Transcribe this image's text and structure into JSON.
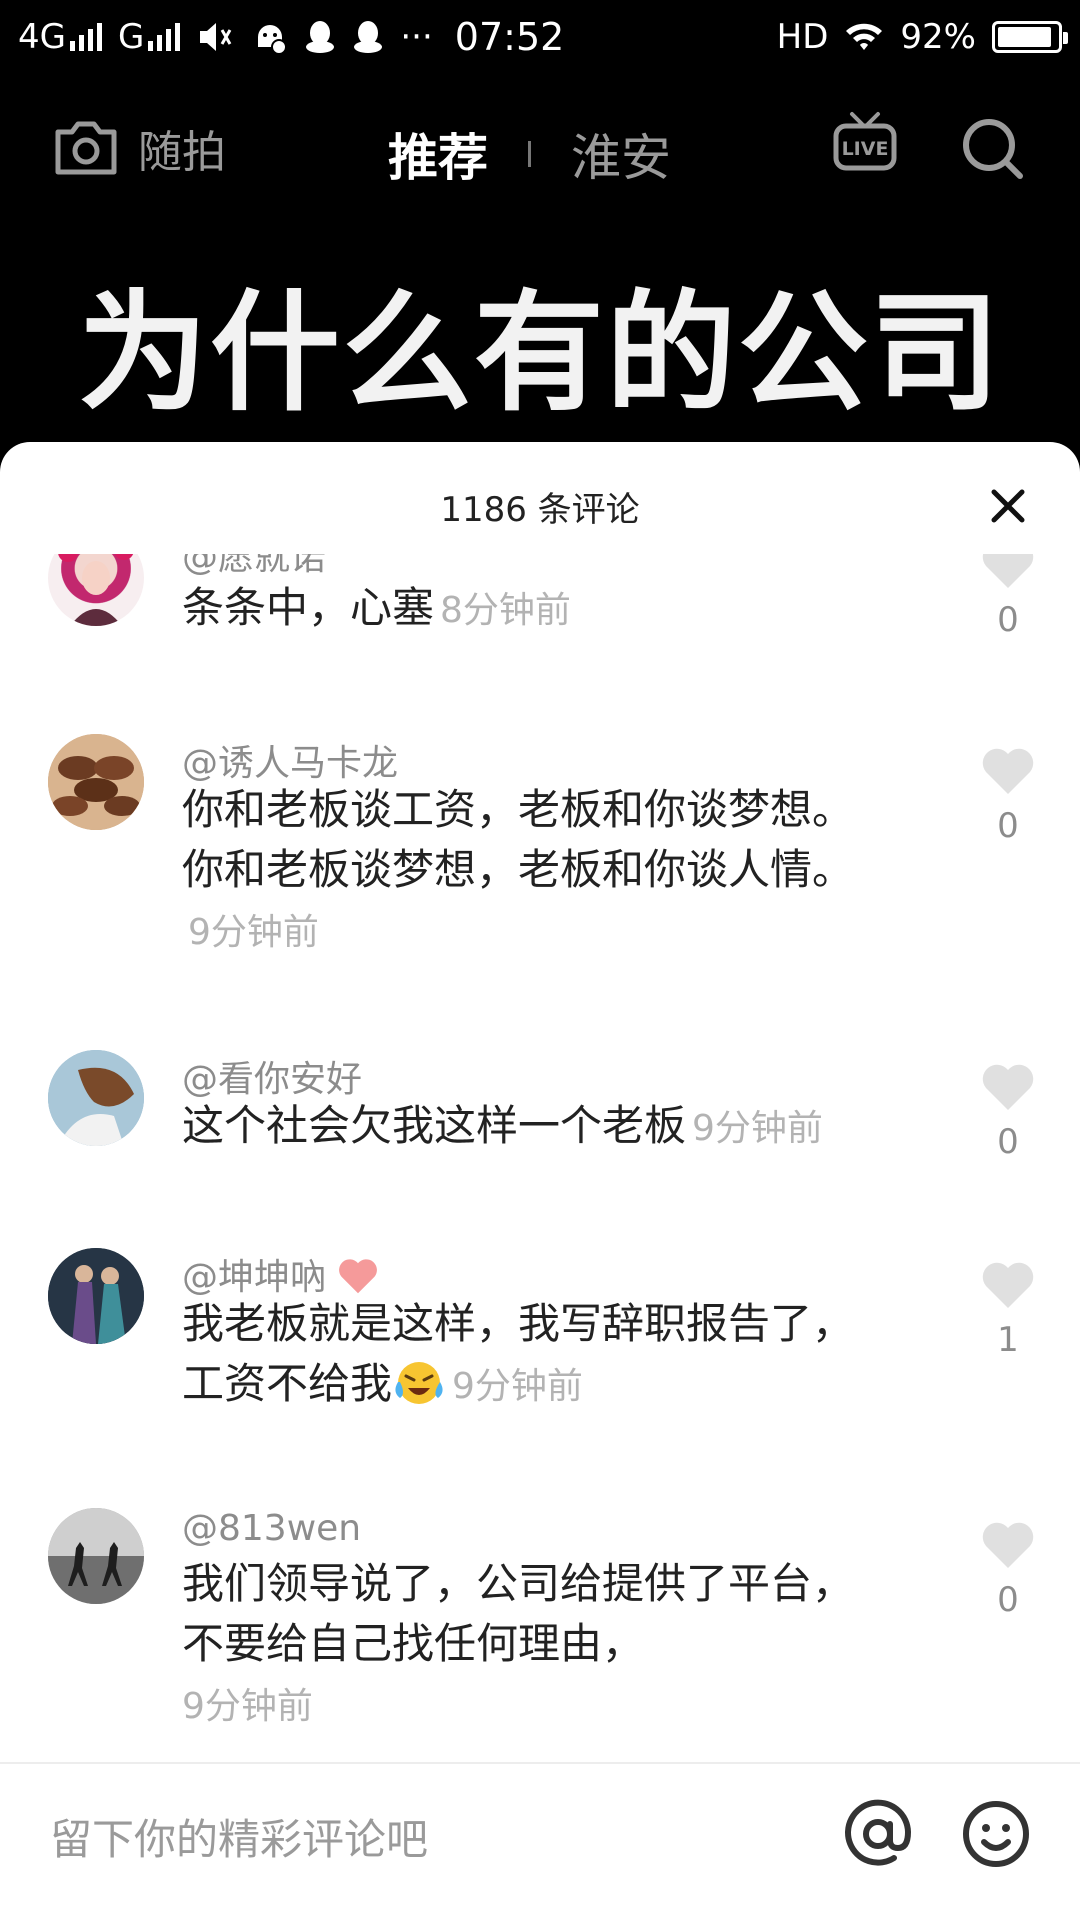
{
  "status_bar": {
    "network_1": "4G",
    "network_2": "G",
    "time": "07:52",
    "hd": "HD",
    "battery": "92%",
    "battery_level": 0.92,
    "more": "···"
  },
  "top_nav": {
    "camera_label": "随拍",
    "tab_recommend": "推荐",
    "tab_local": "淮安",
    "live_badge": "LIVE"
  },
  "video": {
    "headline": "为什么有的公司"
  },
  "comment_sheet": {
    "title": "1186 条评论",
    "comments": [
      {
        "username": "@愿就诺",
        "text": "条条中，心塞",
        "time": "8分钟前",
        "likes": "0",
        "avatar": "avatar-pink-flower"
      },
      {
        "username": "@诱人马卡龙",
        "text": "你和老板谈工资，老板和你谈梦想。你和老板谈梦想，老板和你谈人情。",
        "time": "9分钟前",
        "likes": "0",
        "avatar": "avatar-macarons"
      },
      {
        "username": "@看你安好",
        "text": "这个社会欠我这样一个老板",
        "time": "9分钟前",
        "likes": "0",
        "avatar": "avatar-wind-hair"
      },
      {
        "username": "@坤坤吶",
        "text": "我老板就是这样，我写辞职报告了，工资不给我",
        "time": "9分钟前",
        "likes": "1",
        "avatar": "avatar-couple-stage"
      },
      {
        "username": "@813wen",
        "text": "我们领导说了，公司给提供了平台，不要给自己找任何理由，",
        "time": "9分钟前",
        "likes": "0",
        "avatar": "avatar-beach-silhouettes"
      }
    ]
  },
  "input_bar": {
    "placeholder": "留下你的精彩评论吧"
  },
  "colors": {
    "accent_heart": "#e0e0e0",
    "username_gray": "#8c8c8c",
    "time_gray": "#b3b3b3"
  }
}
